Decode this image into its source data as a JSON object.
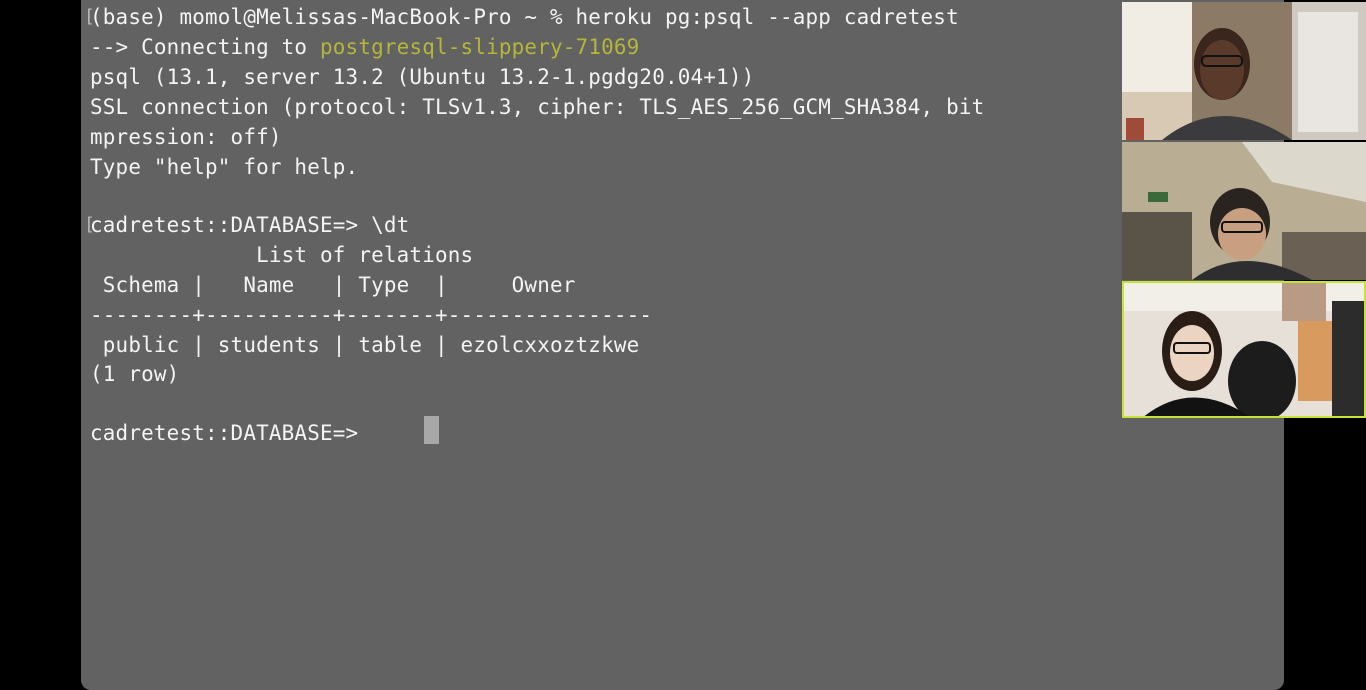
{
  "terminal": {
    "lines": {
      "l1": "(base) momol@Melissas-MacBook-Pro ~ % heroku pg:psql --app cadretest",
      "l2_prefix": "--> Connecting to ",
      "l2_db": "postgresql-slippery-71069",
      "l3": "psql (13.1, server 13.2 (Ubuntu 13.2-1.pgdg20.04+1))",
      "l4": "SSL connection (protocol: TLSv1.3, cipher: TLS_AES_256_GCM_SHA384, bit",
      "l5": "mpression: off)",
      "l6": "Type \"help\" for help.",
      "l8": "cadretest::DATABASE=> \\dt",
      "l9": "             List of relations",
      "l10": " Schema |   Name   | Type  |     Owner",
      "l11": "--------+----------+-------+----------------",
      "l12": " public | students | table | ezolcxxoztzkwe",
      "l13": "(1 row)",
      "l15": "cadretest::DATABASE=> "
    },
    "colors": {
      "background": "#626262",
      "text": "#f4f4f4",
      "highlight": "#b6b63a",
      "cursor": "#a8a8a8"
    }
  },
  "video_call": {
    "participants": [
      {
        "tile": "participant-1",
        "active_speaker": false
      },
      {
        "tile": "participant-2",
        "active_speaker": false
      },
      {
        "tile": "participant-3",
        "active_speaker": true
      }
    ],
    "active_speaker_color": "#c6e33a"
  }
}
